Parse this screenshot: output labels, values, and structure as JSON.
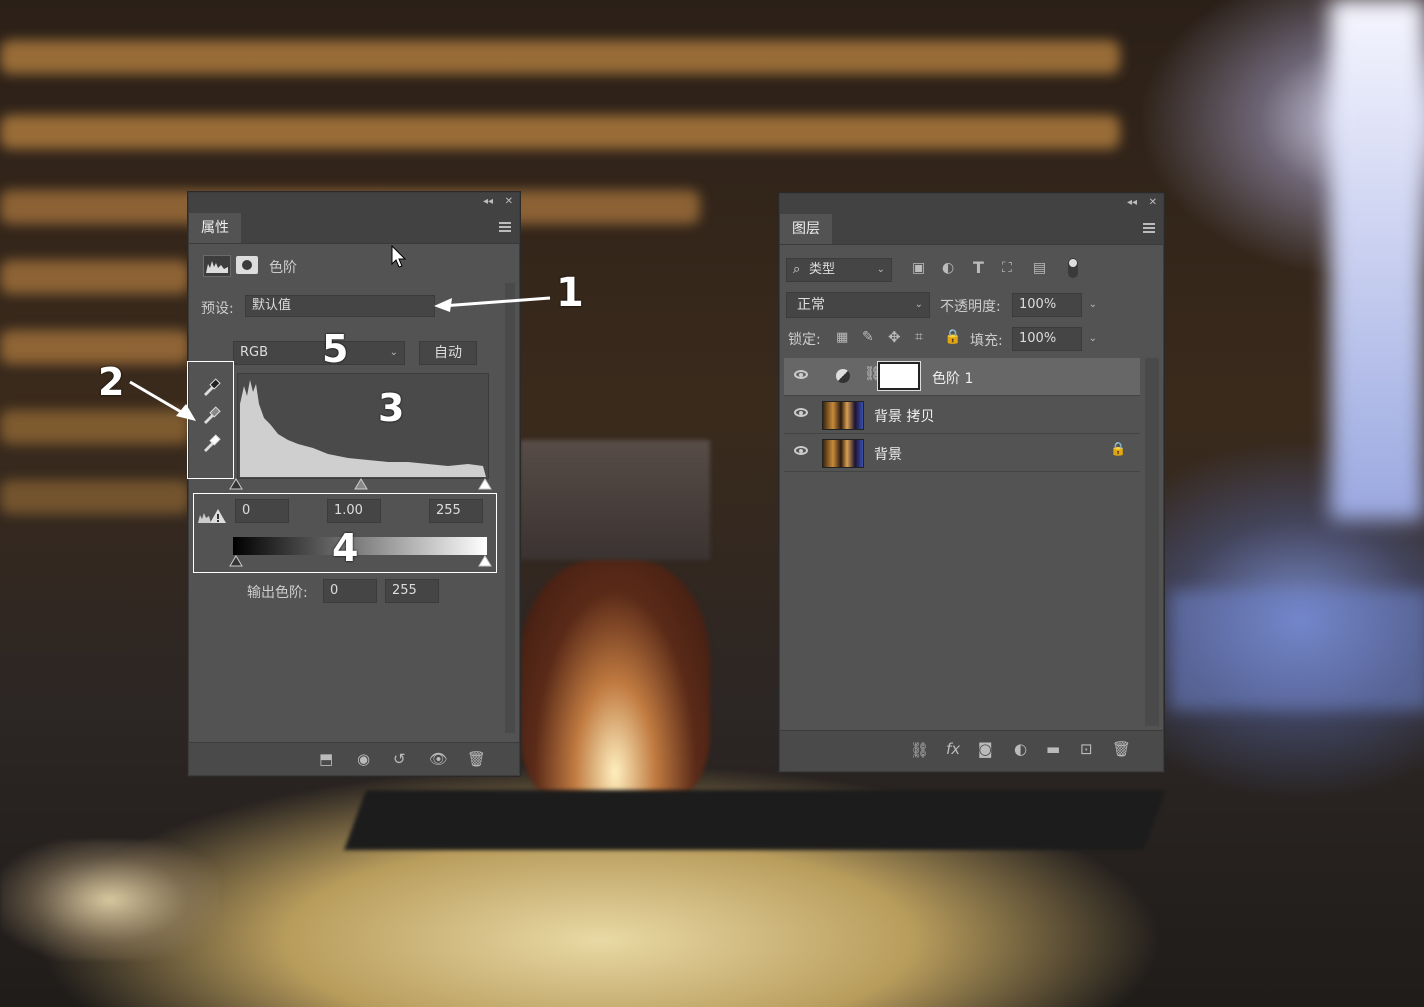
{
  "properties_panel": {
    "tab": "属性",
    "adjustment_name": "色阶",
    "preset_label": "预设:",
    "preset_value": "默认值",
    "channel_value": "RGB",
    "auto_button": "自动",
    "input_black": "0",
    "input_gamma": "1.00",
    "input_white": "255",
    "output_label": "输出色阶:",
    "output_black": "0",
    "output_white": "255"
  },
  "annotations": {
    "a1": "1",
    "a2": "2",
    "a3": "3",
    "a4": "4",
    "a5": "5"
  },
  "layers_panel": {
    "tab": "图层",
    "filter_kind": "类型",
    "blend_mode": "正常",
    "opacity_label": "不透明度:",
    "opacity_value": "100%",
    "lock_label": "锁定:",
    "fill_label": "填充:",
    "fill_value": "100%",
    "layers": [
      {
        "name": "色阶 1",
        "selected": true,
        "type": "adjustment"
      },
      {
        "name": "背景 拷贝",
        "selected": false,
        "type": "image"
      },
      {
        "name": "背景",
        "selected": false,
        "type": "image",
        "locked": true
      }
    ]
  },
  "icons": {
    "histogram": "histogram-icon",
    "mask": "mask-icon",
    "eyedroppers": [
      "black-point-eyedropper-icon",
      "gray-point-eyedropper-icon",
      "white-point-eyedropper-icon"
    ]
  }
}
